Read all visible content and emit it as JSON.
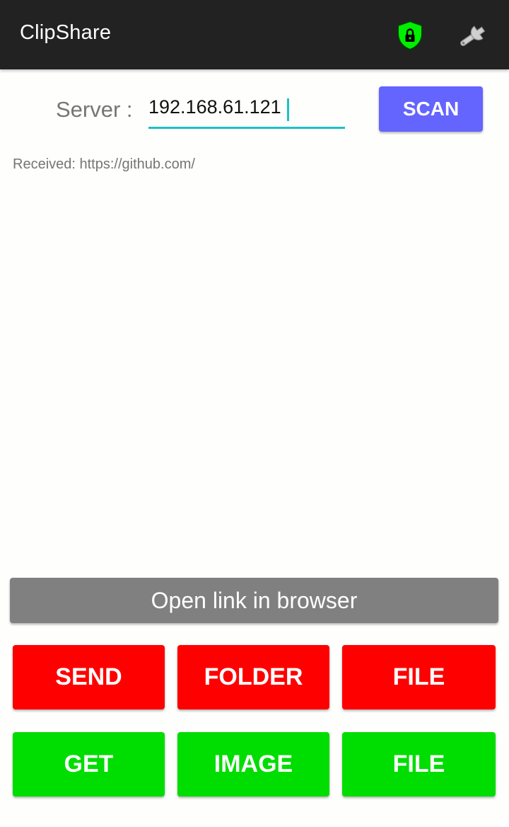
{
  "app": {
    "title": "ClipShare"
  },
  "toolbar": {
    "secure_icon": "shield-lock-icon",
    "secure_icon_color": "#00ee00",
    "settings_icon": "wrench-icon"
  },
  "server": {
    "label": "Server :",
    "value": "192.168.61.121",
    "scan_label": "SCAN"
  },
  "status": {
    "received": "Received: https://github.com/"
  },
  "open_link": {
    "label": "Open link in browser"
  },
  "send_row": {
    "send": "SEND",
    "folder": "FOLDER",
    "file": "FILE"
  },
  "get_row": {
    "get": "GET",
    "image": "IMAGE",
    "file": "FILE"
  },
  "colors": {
    "appbar": "#222222",
    "accent": "#1dc1c7",
    "scan_button": "#6464ff",
    "open_link_button": "#7f807f",
    "send_buttons": "#ff0000",
    "get_buttons": "#00dd00"
  }
}
